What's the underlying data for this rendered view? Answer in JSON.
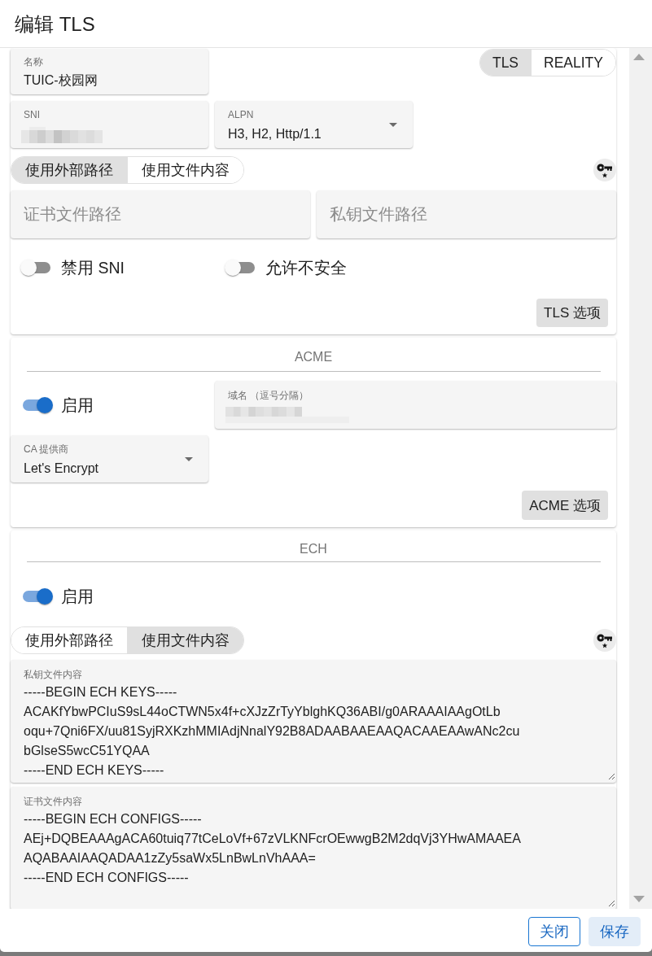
{
  "dialog": {
    "title": "编辑 TLS"
  },
  "tls_card": {
    "name_field": {
      "label": "名称",
      "value": "TUIC-校园网"
    },
    "mode_toggle": [
      {
        "label": "TLS",
        "selected": true
      },
      {
        "label": "REALITY",
        "selected": false
      }
    ],
    "sni_field": {
      "label": "SNI",
      "redacted": true
    },
    "alpn_select": {
      "label": "ALPN",
      "value": "H3, H2, Http/1.1"
    },
    "source_tabs": [
      {
        "label": "使用外部路径",
        "selected": true
      },
      {
        "label": "使用文件内容",
        "selected": false
      }
    ],
    "path_fields": [
      {
        "placeholder": "证书文件路径"
      },
      {
        "placeholder": "私钥文件路径"
      }
    ],
    "switches": [
      {
        "label": "禁用 SNI",
        "on": false
      },
      {
        "label": "允许不安全",
        "on": false
      }
    ],
    "options_button": "TLS 选项"
  },
  "acme_card": {
    "heading": "ACME",
    "enabled_switch": {
      "label": "启用",
      "on": true
    },
    "domain_field": {
      "label": "域名 （逗号分隔）",
      "redacted": true
    },
    "ca_select": {
      "label": "CA 提供商",
      "value": "Let's Encrypt"
    },
    "options_button": "ACME 选项"
  },
  "ech_card": {
    "heading": "ECH",
    "enabled_switch": {
      "label": "启用",
      "on": true
    },
    "source_tabs": [
      {
        "label": "使用外部路径",
        "selected": false
      },
      {
        "label": "使用文件内容",
        "selected": true
      }
    ],
    "text_areas": [
      {
        "label": "私钥文件内容",
        "value": "-----BEGIN ECH KEYS-----\nACAKfYbwPCIuS9sL44oCTWN5x4f+cXJzZrTyYblghKQ36ABI/g0ARAAAIAAgOtLb\noqu+7Qni6FX/uu81SyjRXKzhMMIAdjNnalY92B8ADAABAAEAAQACAAEAAwANc2cu\nbGlseS5wcC51YQAA\n-----END ECH KEYS-----"
      },
      {
        "label": "证书文件内容",
        "value": "-----BEGIN ECH CONFIGS-----\nAEj+DQBEAAAgACA60tuiq77tCeLoVf+67zVLKNFcrOEwwgB2M2dqVj3YHwAMAAEA\nAQABAAIAAQADAA1zZy5saWx5LnBwLnVhAAA=\n-----END ECH CONFIGS-----"
      }
    ]
  },
  "actions": [
    {
      "label": "关闭",
      "kind": "outlined"
    },
    {
      "label": "保存",
      "kind": "contained"
    }
  ]
}
